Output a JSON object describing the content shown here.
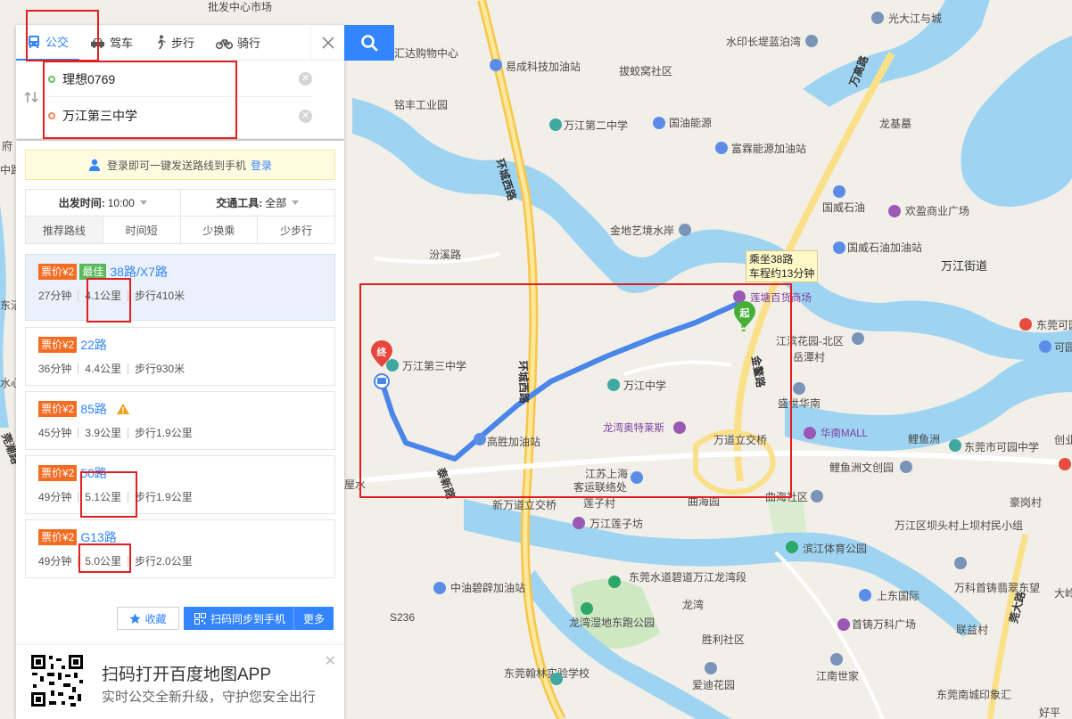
{
  "tabs": [
    {
      "label": "公交",
      "icon": "bus-icon",
      "active": true
    },
    {
      "label": "驾车",
      "icon": "car-icon"
    },
    {
      "label": "步行",
      "icon": "walk-icon"
    },
    {
      "label": "骑行",
      "icon": "bike-icon"
    }
  ],
  "inputs": {
    "start": "理想0769",
    "end": "万江第三中学"
  },
  "login_tip": {
    "text": "登录即可一键发送路线到手机",
    "link": "登录"
  },
  "options": {
    "depart_label": "出发时间:",
    "depart_value": "10:00",
    "tool_label": "交通工具:",
    "tool_value": "全部",
    "sorts": [
      "推荐路线",
      "时间短",
      "少换乘",
      "少步行"
    ]
  },
  "routes": [
    {
      "price": "票价¥2",
      "best": "最佳",
      "name": "38路/X7路",
      "time": "27分钟",
      "distance": "4.1公里",
      "walk": "步行410米"
    },
    {
      "price": "票价¥2",
      "name": "22路",
      "time": "36分钟",
      "distance": "4.4公里",
      "walk": "步行930米"
    },
    {
      "price": "票价¥2",
      "name": "85路",
      "time": "45分钟",
      "distance": "3.9公里",
      "walk": "步行1.9公里"
    },
    {
      "price": "票价¥2",
      "name": "50路",
      "time": "49分钟",
      "distance": "5.1公里",
      "walk": "步行1.9公里"
    },
    {
      "price": "票价¥2",
      "name": "G13路",
      "time": "49分钟",
      "distance": "5.0公里",
      "walk": "步行2.0公里"
    }
  ],
  "actions": {
    "fav": "收藏",
    "scan": "扫码同步到手机",
    "more": "更多"
  },
  "promo": {
    "title": "扫码打开百度地图APP",
    "subtitle": "实时公交全新升级，守护您安全出行"
  },
  "tip": {
    "line1": "乘坐38路",
    "line2": "车程约13分钟"
  },
  "markers": {
    "start": "起",
    "end": "终"
  },
  "map_labels": {
    "top_cut": "批发中心市场",
    "guangda": "光大江与城",
    "shuiyin": "水印长堤蓝泊湾",
    "huida": "汇达购物中心",
    "yicheng": "易成科技加油站",
    "bajiao": "拔蛟窝社区",
    "wangao_rd": "万高路",
    "mingfeng": "铭丰工业园",
    "wanjiang2": "万江第二中学",
    "guoyou": "国油能源",
    "longji": "龙基墓",
    "fulin": "富霖能源加油站",
    "huancheng_w": "环城西路",
    "guowei": "国威石油",
    "huanying": "欢盈商业广场",
    "jindi": "金地艺境水岸",
    "guowei2": "国威石油加油站",
    "fenxi": "汾溪路",
    "wanjiang_st": "万江街道",
    "lotang": "莲塘百货商场",
    "jiangbin": "江滨花园-北区",
    "yuetan": "岳潭村",
    "dongguan_k": "东莞可园",
    "kejian": "可园",
    "wanjiang3": "万江第三中学",
    "huancheng": "环城西路",
    "wanjiang_mid": "万江中学",
    "jinao": "金鳌路",
    "shenghua": "盛世华南",
    "longwan": "龙湾奥特莱斯",
    "huanan": "华南MALL",
    "liyu": "鲤鱼洲",
    "dongguan_ky": "东莞市可园中学",
    "chuangye": "创业",
    "gaosheng": "高胜加油站",
    "wanjiang_jiaochaqiao": "万道立交桥",
    "liyu_cult": "鲤鱼洲文创园",
    "jiangsu": "江苏上海",
    "keyun": "客运联络处",
    "taixin": "泰新路",
    "xinwan": "新万道立交桥",
    "lianzi": "莲子村",
    "quhai": "曲海园",
    "quhai_sq": "曲海社区",
    "haogang": "豪岗村",
    "wanjiang_b": "万江区坝头村上坝村民小组",
    "wanjiang_lz": "万江莲子坊",
    "binjiang": "滨江体育公园",
    "zhongyou": "中油碧辟加油站",
    "dongguan_sd": "东莞水道碧道万江龙湾段",
    "shangdong": "上东国际",
    "wanke": "万科首铸翡翠东望",
    "dahe": "大岭",
    "longwan_park": "龙湾湿地东跑公园",
    "longwan2": "龙湾",
    "shouzhu": "首铸万科广场",
    "guanda_rd": "莞大路",
    "lianhe": "联益村",
    "s236": "S236",
    "shengli": "胜利社区",
    "hanlin": "东莞翰林实验学校",
    "jiangnan": "江南世家",
    "aidi": "爱迪花园",
    "dongguan_nc": "东莞南城印象汇",
    "haoping": "好平",
    "bf_left1": "府",
    "bf_left2": "中路",
    "bf_left3": "东沼",
    "bf_left4": "水心",
    "bf_left5": "莞潮路",
    "bf_left6": "屋水"
  }
}
